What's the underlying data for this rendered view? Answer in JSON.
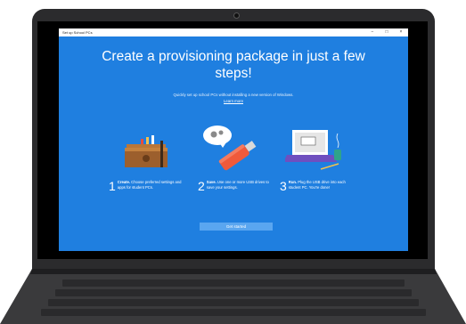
{
  "window": {
    "title": "Set up School PCs",
    "minimize": "−",
    "maximize": "□",
    "close": "×"
  },
  "main": {
    "headline": "Create a provisioning package in just a few steps!",
    "subtitle": "Quickly set up school PCs without installing a new version of Windows.",
    "learn_more": "Learn more"
  },
  "steps": [
    {
      "number": "1",
      "title": "Create.",
      "text": "Choose preferred settings and apps for student PCs.",
      "icon": "toolbox-icon"
    },
    {
      "number": "2",
      "title": "Save.",
      "text": "Use one or more USB drives to save your settings.",
      "icon": "usb-drive-icon"
    },
    {
      "number": "3",
      "title": "Run.",
      "text": "Plug the USB drive into each student PC. You're done!",
      "icon": "laptop-icon"
    }
  ],
  "cta": {
    "label": "Get started"
  },
  "colors": {
    "accent": "#1f7fe0",
    "button": "#5aa6f0"
  }
}
